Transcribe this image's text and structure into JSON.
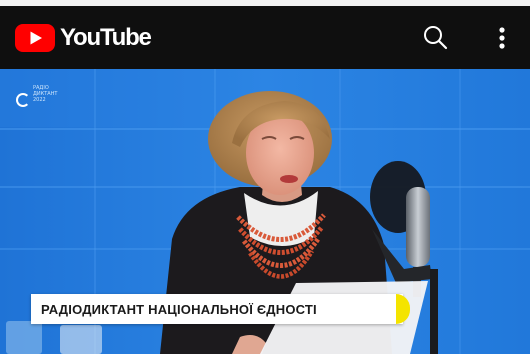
{
  "app": {
    "name": "YouTube",
    "icons": {
      "logo": "youtube-play-logo",
      "search": "search-icon",
      "menu": "more-vertical-icon"
    },
    "colors": {
      "brand_red": "#ff0000",
      "topbar_bg": "#0f0f0f",
      "accent_yellow": "#f4e400"
    }
  },
  "video": {
    "event_logo_text": "РАДІО\nДИКТАНТ\n2022",
    "lower_third_title": "РАДІОДИКТАНТ НАЦІОНАЛЬНОЇ ЄДНОСТІ"
  }
}
